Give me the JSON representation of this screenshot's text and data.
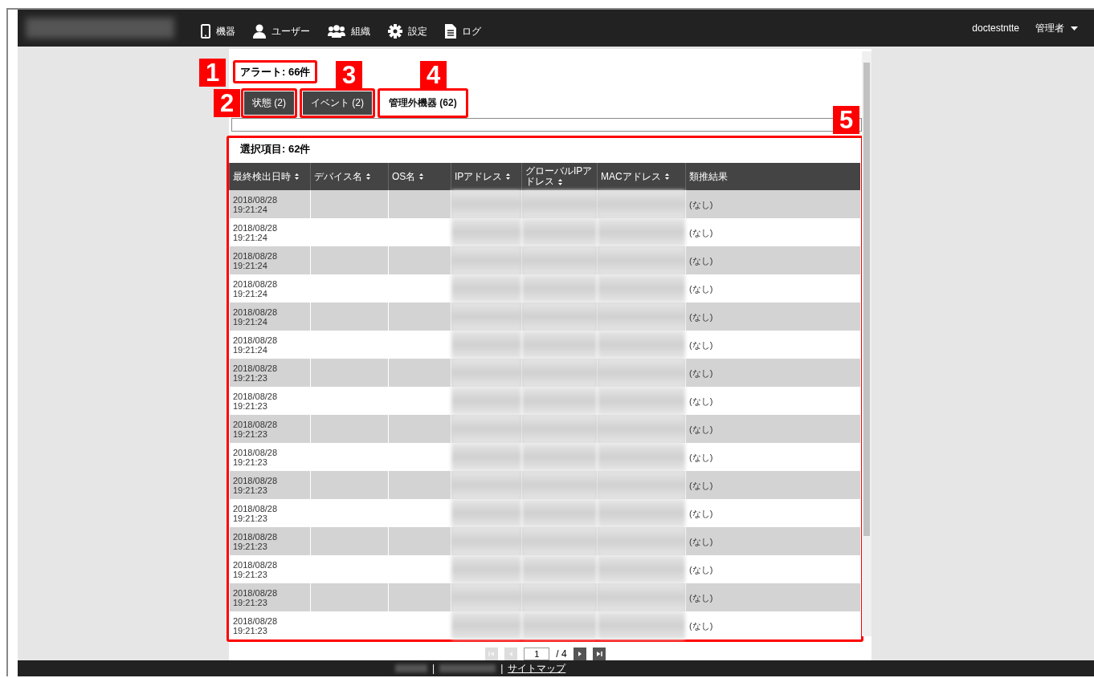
{
  "header": {
    "nav": [
      {
        "kind": "device",
        "label": "機器"
      },
      {
        "kind": "user",
        "label": "ユーザー"
      },
      {
        "kind": "group",
        "label": "組織"
      },
      {
        "kind": "gear",
        "label": "設定"
      },
      {
        "kind": "doc",
        "label": "ログ"
      }
    ],
    "user": "doctestntte",
    "role": "管理者"
  },
  "alert": {
    "title": "アラート: 66件",
    "callout": "1"
  },
  "tabs": [
    {
      "label": "状態 (2)",
      "selected": false,
      "callout": "2"
    },
    {
      "label": "イベント (2)",
      "selected": false,
      "callout": "3"
    },
    {
      "label": "管理外機器 (62)",
      "selected": true,
      "callout": "4"
    }
  ],
  "selection": {
    "title": "選択項目: 62件",
    "callout": "5"
  },
  "table": {
    "columns": [
      {
        "label": "最終検出日時",
        "sortable": true
      },
      {
        "label": "デバイス名",
        "sortable": true
      },
      {
        "label": "OS名",
        "sortable": true
      },
      {
        "label": "IPアドレス",
        "sortable": true
      },
      {
        "label": "グローバルIPアドレス",
        "sortable": true
      },
      {
        "label": "MACアドレス",
        "sortable": true
      },
      {
        "label": "類推結果",
        "sortable": false
      }
    ],
    "rows": [
      {
        "detected": "2018/08/28 19:21:24",
        "result": "(なし)"
      },
      {
        "detected": "2018/08/28 19:21:24",
        "result": "(なし)"
      },
      {
        "detected": "2018/08/28 19:21:24",
        "result": "(なし)"
      },
      {
        "detected": "2018/08/28 19:21:24",
        "result": "(なし)"
      },
      {
        "detected": "2018/08/28 19:21:24",
        "result": "(なし)"
      },
      {
        "detected": "2018/08/28 19:21:24",
        "result": "(なし)"
      },
      {
        "detected": "2018/08/28 19:21:23",
        "result": "(なし)"
      },
      {
        "detected": "2018/08/28 19:21:23",
        "result": "(なし)"
      },
      {
        "detected": "2018/08/28 19:21:23",
        "result": "(なし)"
      },
      {
        "detected": "2018/08/28 19:21:23",
        "result": "(なし)"
      },
      {
        "detected": "2018/08/28 19:21:23",
        "result": "(なし)"
      },
      {
        "detected": "2018/08/28 19:21:23",
        "result": "(なし)"
      },
      {
        "detected": "2018/08/28 19:21:23",
        "result": "(なし)"
      },
      {
        "detected": "2018/08/28 19:21:23",
        "result": "(なし)"
      },
      {
        "detected": "2018/08/28 19:21:23",
        "result": "(なし)"
      },
      {
        "detected": "2018/08/28 19:21:23",
        "result": "(なし)"
      }
    ]
  },
  "pagination": {
    "buttons": [
      {
        "kind": "first",
        "disabled": true
      },
      {
        "kind": "prev",
        "disabled": true
      },
      {
        "kind": "next",
        "disabled": false
      },
      {
        "kind": "last",
        "disabled": false
      }
    ],
    "page": "1",
    "total": "/ 4"
  },
  "footer": {
    "separators": [
      "|",
      "|"
    ],
    "link": "サイトマップ"
  }
}
